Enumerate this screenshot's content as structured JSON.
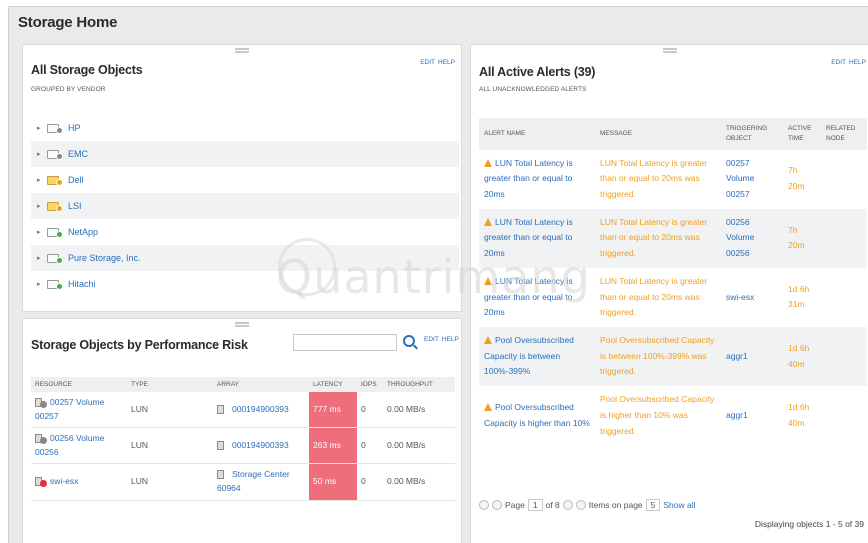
{
  "page": {
    "title": "Storage Home"
  },
  "storage_objects": {
    "title": "All Storage Objects",
    "subtitle": "Grouped by vendor",
    "edit": "EDIT",
    "help": "HELP",
    "vendors": [
      {
        "label": "HP",
        "status_color": "#888888",
        "folder": "plain"
      },
      {
        "label": "EMC",
        "status_color": "#888888",
        "folder": "plain"
      },
      {
        "label": "Dell",
        "status_color": "#f0a020",
        "folder": "yellow"
      },
      {
        "label": "LSI",
        "status_color": "#f0a020",
        "folder": "yellow"
      },
      {
        "label": "NetApp",
        "status_color": "#3cb04a",
        "folder": "plain"
      },
      {
        "label": "Pure Storage, Inc.",
        "status_color": "#3cb04a",
        "folder": "plain"
      },
      {
        "label": "Hitachi",
        "status_color": "#3cb04a",
        "folder": "plain"
      }
    ]
  },
  "perf_risk": {
    "title": "Storage Objects by Performance Risk",
    "edit": "EDIT",
    "help": "HELP",
    "search_placeholder": "",
    "columns": [
      "Resource",
      "Type",
      "Array",
      "Latency",
      "IOPS",
      "Throughput"
    ],
    "rows": [
      {
        "resource": "00257 Volume 00257",
        "type": "LUN",
        "array": "000194900393",
        "latency": "777 ms",
        "iops": "0",
        "throughput": "0.00 MB/s",
        "status_color": "#888888"
      },
      {
        "resource": "00256 Volume 00256",
        "type": "LUN",
        "array": "000194900393",
        "latency": "263 ms",
        "iops": "0",
        "throughput": "0.00 MB/s",
        "status_color": "#888888"
      },
      {
        "resource": "swi-esx",
        "type": "LUN",
        "array": "Storage Center 60964",
        "latency": "50 ms",
        "iops": "0",
        "throughput": "0.00 MB/s",
        "status_color": "#e0303a"
      }
    ]
  },
  "alerts": {
    "title": "All Active Alerts (39)",
    "subtitle": "All unacknowledged alerts",
    "edit": "EDIT",
    "help": "HELP",
    "columns": [
      "Alert name",
      "Message",
      "Triggering object",
      "Active time",
      "Related node"
    ],
    "rows": [
      {
        "name": "LUN Total Latency is greater than or equal to 20ms",
        "message": "LUN Total Latency is greater than or equal to 20ms was triggered.",
        "object": "00257 Volume 00257",
        "time": "7h 20m",
        "node": ""
      },
      {
        "name": "LUN Total Latency is greater than or equal to 20ms",
        "message": "LUN Total Latency is greater than or equal to 20ms was triggered.",
        "object": "00256 Volume 00256",
        "time": "7h 20m",
        "node": ""
      },
      {
        "name": "LUN Total Latency is greater than or equal to 20ms",
        "message": "LUN Total Latency is greater than or equal to 20ms was triggered.",
        "object": "swi-esx",
        "time": "1d 6h 31m",
        "node": ""
      },
      {
        "name": "Pool Oversubscribed Capacity is between 100%-399%",
        "message": "Pool Oversubscribed Capacity is between 100%-399% was triggered.",
        "object": "aggr1",
        "time": "1d 6h 40m",
        "node": ""
      },
      {
        "name": "Pool Oversubscribed Capacity is higher than 10%",
        "message": "Pool Oversubscribed Capacity is higher than 10% was triggered.",
        "object": "aggr1",
        "time": "1d 6h 40m",
        "node": ""
      }
    ],
    "pager": {
      "page_label": "Page",
      "page": "1",
      "of_label": "of 8",
      "items_label": "Items on page",
      "items": "5",
      "show_all": "Show all"
    },
    "displaying": "Displaying objects 1 - 5 of 39"
  },
  "watermark": {
    "text": "Quantrimang"
  }
}
